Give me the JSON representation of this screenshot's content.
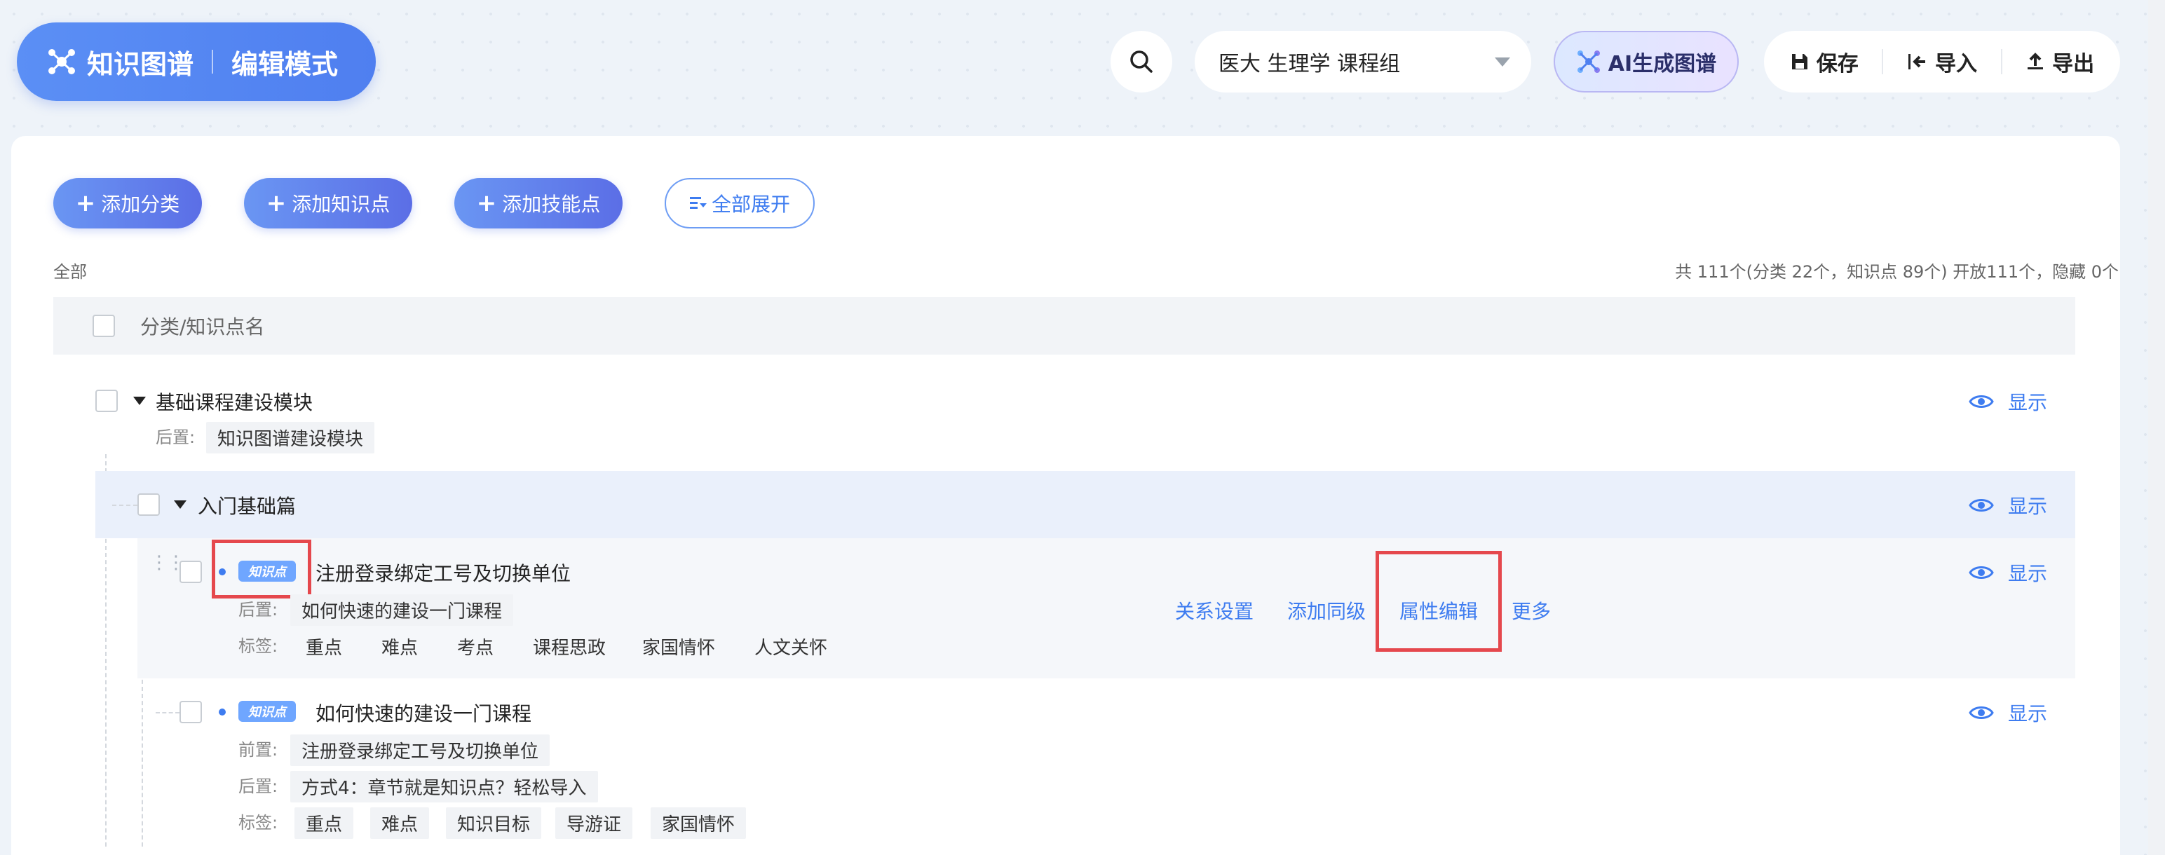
{
  "header": {
    "brand_title": "知识图谱",
    "brand_mode": "编辑模式",
    "course_select_value": "医大 生理学 课程组",
    "ai_button_label": "AI生成图谱",
    "save_label": "保存",
    "import_label": "导入",
    "export_label": "导出"
  },
  "actions": {
    "add_category": "添加分类",
    "add_knowledge_point": "添加知识点",
    "add_skill_point": "添加技能点",
    "expand_all": "全部展开"
  },
  "filter_label": "全部",
  "stats_text": "共 111个(分类 22个，知识点 89个) 开放111个，隐藏 0个",
  "table_header": "分类/知识点名",
  "labels": {
    "after": "后置:",
    "before": "前置:",
    "tags": "标签:",
    "show": "显示",
    "badge": "知识点"
  },
  "rows": [
    {
      "title": "基础课程建设模块",
      "after": [
        "知识图谱建设模块"
      ]
    },
    {
      "title": "入门基础篇"
    },
    {
      "title": "注册登录绑定工号及切换单位",
      "after": [
        "如何快速的建设一门课程"
      ],
      "tags": [
        "重点",
        "难点",
        "考点",
        "课程思政",
        "家国情怀",
        "人文关怀"
      ],
      "row_actions": [
        "关系设置",
        "添加同级",
        "属性编辑",
        "更多"
      ]
    },
    {
      "title": "如何快速的建设一门课程",
      "before": [
        "注册登录绑定工号及切换单位"
      ],
      "after": [
        "方式4：章节就是知识点？轻松导入"
      ],
      "tags": [
        "重点",
        "难点",
        "知识目标",
        "导游证",
        "家国情怀"
      ]
    }
  ],
  "colors": {
    "accent": "#3e7cf0",
    "highlight": "#e5484d",
    "badge": "#6fa6ff"
  }
}
